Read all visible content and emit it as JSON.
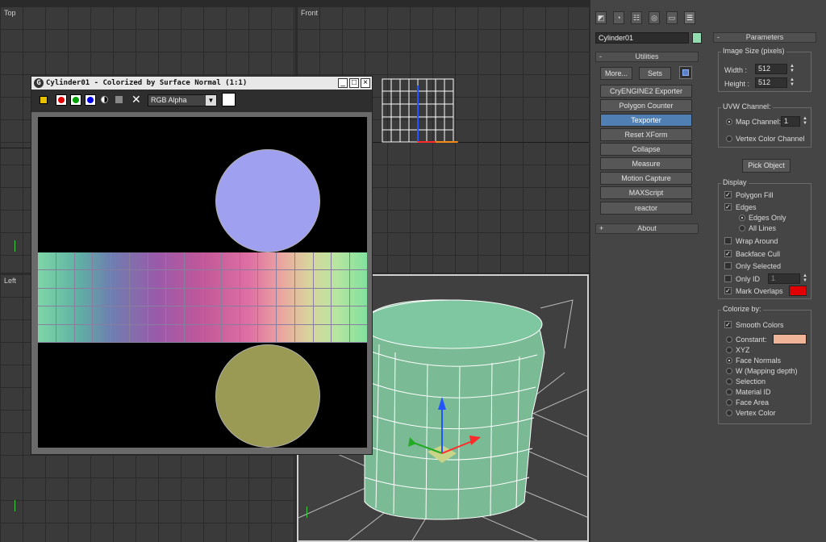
{
  "viewports": {
    "top_label": "Top",
    "front_label": "Front",
    "left_label": "Left"
  },
  "command_panel": {
    "object_name": "Cylinder01",
    "object_color": "#93dcb0",
    "utilities_label": "Utilities",
    "more_label": "More...",
    "sets_label": "Sets",
    "utilities": [
      "CryENGINE2 Exporter",
      "Polygon Counter",
      "Texporter",
      "Reset XForm",
      "Collapse",
      "Measure",
      "Motion Capture",
      "MAXScript",
      "reactor"
    ],
    "active_utility": "Texporter",
    "about_label": "About",
    "minus": "-",
    "plus": "+"
  },
  "parameters": {
    "header": "Parameters",
    "image_size_label": "Image Size (pixels)",
    "width_label": "Width :",
    "width_value": "512",
    "height_label": "Height :",
    "height_value": "512",
    "uvw_label": "UVW Channel:",
    "map_channel_label": "Map Channel:",
    "map_channel_value": "1",
    "vertex_color_channel_label": "Vertex Color Channel",
    "pick_object_label": "Pick Object",
    "display_label": "Display",
    "polygon_fill_label": "Polygon Fill",
    "edges_label": "Edges",
    "edges_only_label": "Edges Only",
    "all_lines_label": "All Lines",
    "wrap_around_label": "Wrap Around",
    "backface_cull_label": "Backface Cull",
    "only_selected_label": "Only Selected",
    "only_id_label": "Only ID",
    "only_id_value": "1",
    "mark_overlaps_label": "Mark Overlaps",
    "mark_overlaps_color": "#e00000",
    "colorize_by_label": "Colorize by:",
    "smooth_colors_label": "Smooth Colors",
    "constant_label": "Constant:",
    "constant_color": "#f0b498",
    "colorize_options": [
      "XYZ",
      "Face Normals",
      "W (Mapping depth)",
      "Selection",
      "Material ID",
      "Face Area",
      "Vertex Color"
    ],
    "colorize_selected": "Face Normals"
  },
  "render_window": {
    "title": "Cylinder01 - Colorized by Surface Normal (1:1)",
    "channel_select": "RGB Alpha",
    "minimize": "_",
    "maximize": "□",
    "close": "×",
    "circle_top_color": "#a0a0f0",
    "circle_bottom_color": "#9a9a54"
  }
}
